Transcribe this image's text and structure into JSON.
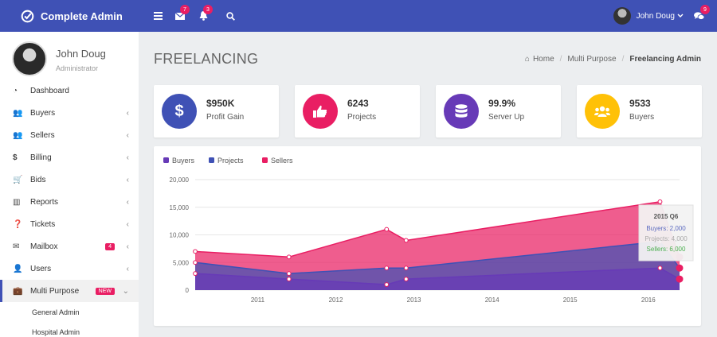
{
  "brand": {
    "title": "Complete Admin"
  },
  "topbar": {
    "mail_badge": "7",
    "bell_badge": "3",
    "user_name": "John Doug",
    "chat_badge": "9"
  },
  "profile": {
    "name": "John Doug",
    "role": "Administrator"
  },
  "sidebar": {
    "items": [
      {
        "label": "Dashboard",
        "icon": "dashboard-icon"
      },
      {
        "label": "Buyers",
        "icon": "users-icon"
      },
      {
        "label": "Sellers",
        "icon": "users-icon"
      },
      {
        "label": "Billing",
        "icon": "dollar-icon"
      },
      {
        "label": "Bids",
        "icon": "cart-icon"
      },
      {
        "label": "Reports",
        "icon": "bar-chart-icon"
      },
      {
        "label": "Tickets",
        "icon": "question-icon"
      },
      {
        "label": "Mailbox",
        "icon": "envelope-icon",
        "badge": "4"
      },
      {
        "label": "Users",
        "icon": "user-icon"
      },
      {
        "label": "Multi Purpose",
        "icon": "briefcase-icon",
        "badge": "NEW"
      }
    ],
    "sub_items": [
      {
        "label": "General Admin"
      },
      {
        "label": "Hospital Admin"
      }
    ]
  },
  "page": {
    "title": "FREELANCING",
    "breadcrumb": [
      "Home",
      "Multi Purpose",
      "Freelancing Admin"
    ]
  },
  "stats": [
    {
      "value": "$950K",
      "label": "Profit Gain",
      "color": "#3f51b5",
      "icon": "dollar-icon"
    },
    {
      "value": "6243",
      "label": "Projects",
      "color": "#e91e63",
      "icon": "thumbs-up-icon"
    },
    {
      "value": "99.9%",
      "label": "Server Up",
      "color": "#673ab7",
      "icon": "database-icon"
    },
    {
      "value": "9533",
      "label": "Buyers",
      "color": "#ffc107",
      "icon": "users-icon"
    }
  ],
  "chart_data": {
    "type": "area",
    "legend": [
      {
        "name": "Buyers",
        "color": "#673ab7"
      },
      {
        "name": "Projects",
        "color": "#3f51b5"
      },
      {
        "name": "Sellers",
        "color": "#e91e63"
      }
    ],
    "x_ticks": [
      "2011",
      "2012",
      "2013",
      "2014",
      "2015",
      "2016"
    ],
    "y_ticks": [
      "0",
      "5,000",
      "10,000",
      "15,000",
      "20,000"
    ],
    "ylim": [
      0,
      20000
    ],
    "x": [
      2010.2,
      2011.4,
      2012.65,
      2012.9,
      2016.15,
      2016.4
    ],
    "series": [
      {
        "name": "Buyers",
        "color": "#673ab7",
        "values": [
          3000,
          2000,
          1000,
          2000,
          4000,
          2000
        ]
      },
      {
        "name": "Projects",
        "color": "#3f51b5",
        "values": [
          5000,
          3000,
          4000,
          4000,
          8800,
          4000
        ]
      },
      {
        "name": "Sellers",
        "color": "#e91e63",
        "values": [
          7000,
          6000,
          11000,
          9000,
          16000,
          6000
        ]
      }
    ],
    "tooltip": {
      "title": "2015 Q6",
      "lines": [
        {
          "text": "Buyers: 2,000",
          "color": "#5c6bc0"
        },
        {
          "text": "Projects: 4,000",
          "color": "#aaaaaa"
        },
        {
          "text": "Sellers: 6,000",
          "color": "#4caf50"
        }
      ]
    }
  }
}
